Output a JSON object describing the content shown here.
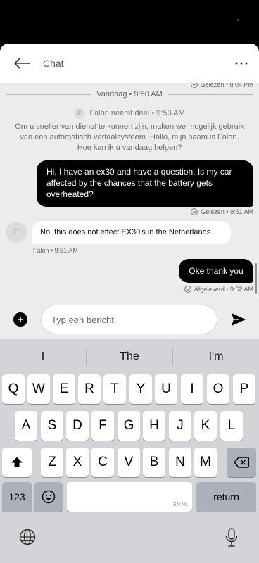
{
  "header": {
    "title": "Chat",
    "back_icon": "back-arrow-icon",
    "more_icon": "more-horizontal-icon"
  },
  "chat": {
    "top_read_status": "Gelezen • 8:04 PM",
    "date_divider": "Vandaag • 9:50 AM",
    "joined": {
      "avatar_letter": "F",
      "text": "Falon neemt deel • 9:50 AM"
    },
    "system_message": "Om u sneller van dienst te kunnen zijn, maken we mogelijk gebruik van een automatisch vertaalsysteem. Hallo, mijn naam is Falon. Hoe kan ik u vandaag helpen?",
    "messages": [
      {
        "direction": "outgoing",
        "text": "Hi, I have an ex30 and have a question. Is my car affected by the chances that the battery gets overheated?",
        "status": "Gelezen • 9:51 AM"
      },
      {
        "direction": "incoming",
        "avatar_letter": "F",
        "text": "No, this does not effect EX30's in the Netherlands.",
        "sender_meta": "Falon • 9:51 AM"
      },
      {
        "direction": "outgoing",
        "text": "Oke thank you",
        "status": "Afgeleverd • 9:52 AM"
      }
    ]
  },
  "composer": {
    "placeholder": "Typ een bericht",
    "add_icon": "plus-circle-icon",
    "send_icon": "send-icon"
  },
  "keyboard": {
    "suggestions": [
      "I",
      "The",
      "I'm"
    ],
    "row1": [
      "Q",
      "W",
      "E",
      "R",
      "T",
      "Y",
      "U",
      "I",
      "O",
      "P"
    ],
    "row2": [
      "A",
      "S",
      "D",
      "F",
      "G",
      "H",
      "J",
      "K",
      "L"
    ],
    "row3": [
      "Z",
      "X",
      "C",
      "V",
      "B",
      "N",
      "M"
    ],
    "numbers_label": "123",
    "return_label": "return",
    "language_hint": "EN NL",
    "icons": [
      "shift-icon",
      "backspace-icon",
      "emoji-icon",
      "globe-icon",
      "microphone-icon"
    ]
  },
  "colors": {
    "outgoing_bubble": "#000000",
    "incoming_bubble": "#ffffff",
    "chat_background": "#ececec",
    "keyboard_background": "#d2d4d8"
  }
}
